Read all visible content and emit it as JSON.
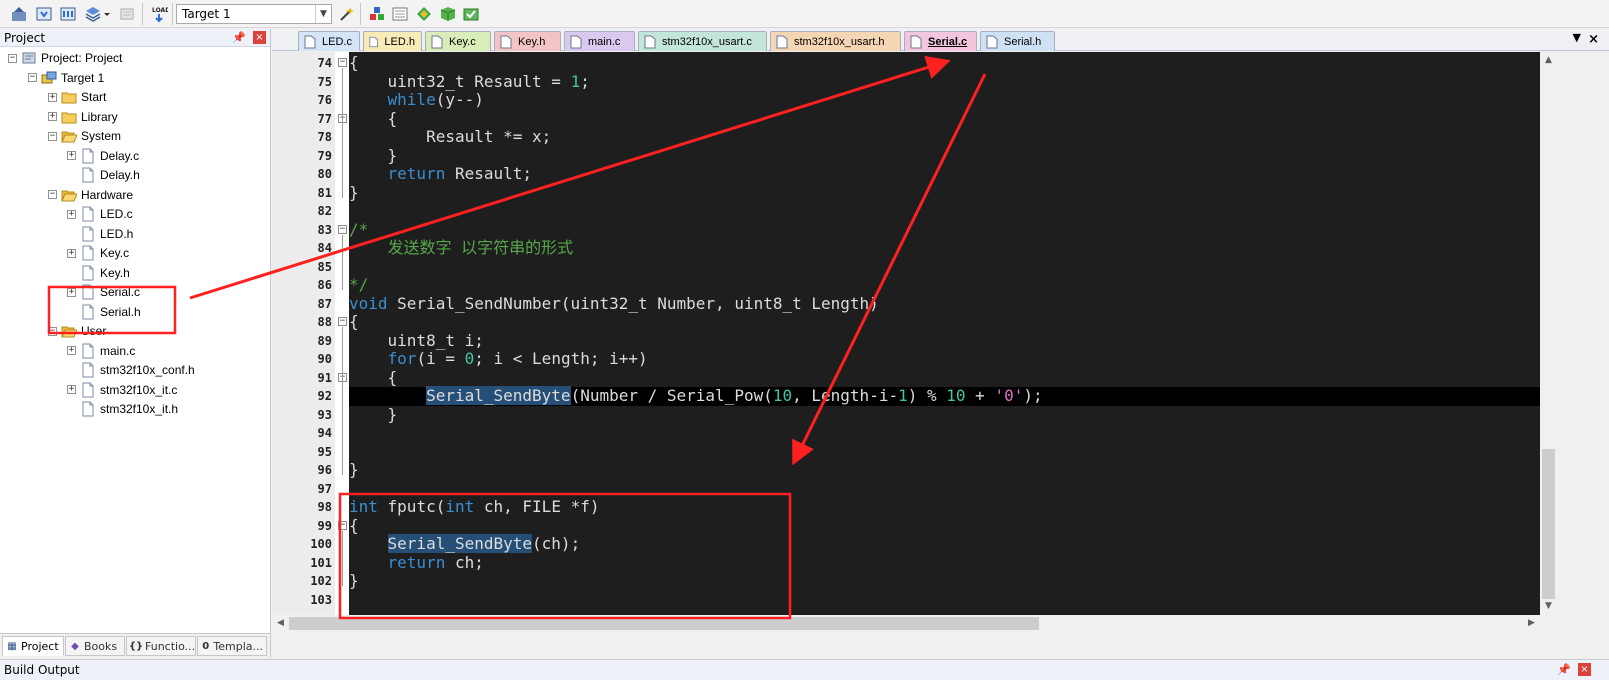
{
  "toolbar": {
    "target_value": "Target 1"
  },
  "project_panel": {
    "title": "Project",
    "pin_icon": "pin-icon",
    "tree": [
      {
        "label": "Project: Project",
        "level": 0,
        "icon": "project-icon",
        "toggle": "-"
      },
      {
        "label": "Target 1",
        "level": 1,
        "icon": "target-icon",
        "toggle": "-"
      },
      {
        "label": "Start",
        "level": 2,
        "icon": "folder-icon",
        "toggle": "+"
      },
      {
        "label": "Library",
        "level": 2,
        "icon": "folder-icon",
        "toggle": "+"
      },
      {
        "label": "System",
        "level": 2,
        "icon": "folder-open-icon",
        "toggle": "-"
      },
      {
        "label": "Delay.c",
        "level": 3,
        "icon": "file-icon",
        "toggle": "+"
      },
      {
        "label": "Delay.h",
        "level": 3,
        "icon": "file-icon",
        "toggle": ""
      },
      {
        "label": "Hardware",
        "level": 2,
        "icon": "folder-open-icon",
        "toggle": "-"
      },
      {
        "label": "LED.c",
        "level": 3,
        "icon": "file-icon",
        "toggle": "+"
      },
      {
        "label": "LED.h",
        "level": 3,
        "icon": "file-icon",
        "toggle": ""
      },
      {
        "label": "Key.c",
        "level": 3,
        "icon": "file-icon",
        "toggle": "+"
      },
      {
        "label": "Key.h",
        "level": 3,
        "icon": "file-icon",
        "toggle": ""
      },
      {
        "label": "Serial.c",
        "level": 3,
        "icon": "file-icon",
        "toggle": "+"
      },
      {
        "label": "Serial.h",
        "level": 3,
        "icon": "file-icon",
        "toggle": ""
      },
      {
        "label": "User",
        "level": 2,
        "icon": "folder-open-icon",
        "toggle": "-"
      },
      {
        "label": "main.c",
        "level": 3,
        "icon": "file-icon",
        "toggle": "+"
      },
      {
        "label": "stm32f10x_conf.h",
        "level": 3,
        "icon": "file-icon",
        "toggle": ""
      },
      {
        "label": "stm32f10x_it.c",
        "level": 3,
        "icon": "file-icon",
        "toggle": "+"
      },
      {
        "label": "stm32f10x_it.h",
        "level": 3,
        "icon": "file-icon",
        "toggle": ""
      }
    ],
    "bottom_tabs": [
      {
        "label": "Project",
        "icon": "project-tab-icon",
        "active": true
      },
      {
        "label": "Books",
        "icon": "books-icon",
        "active": false
      },
      {
        "label": "Functio...",
        "icon": "functions-icon",
        "active": false
      },
      {
        "label": "Templa...",
        "icon": "templates-icon",
        "active": false
      }
    ]
  },
  "editor_tabs": [
    {
      "label": "LED.c",
      "color": "#d6e4f7",
      "active": false
    },
    {
      "label": "LED.h",
      "color": "#f7ecb8",
      "active": false
    },
    {
      "label": "Key.c",
      "color": "#d9edb8",
      "active": false
    },
    {
      "label": "Key.h",
      "color": "#f3c4c6",
      "active": false
    },
    {
      "label": "main.c",
      "color": "#d9c9ee",
      "active": false
    },
    {
      "label": "stm32f10x_usart.c",
      "color": "#c4e6da",
      "active": false
    },
    {
      "label": "stm32f10x_usart.h",
      "color": "#f5d6b4",
      "active": false
    },
    {
      "label": "Serial.c",
      "color": "#f3c6dd",
      "active": true
    },
    {
      "label": "Serial.h",
      "color": "#cfe1f4",
      "active": false
    }
  ],
  "code_lines": [
    {
      "n": "74",
      "fold": "-",
      "html": "{"
    },
    {
      "n": "75",
      "fold": "",
      "html": "    uint32_t Resault = <span class=\"num\">1</span>;"
    },
    {
      "n": "76",
      "fold": "",
      "html": "    <span class=\"kw\">while</span>(y--)"
    },
    {
      "n": "77",
      "fold": "-",
      "html": "    {"
    },
    {
      "n": "78",
      "fold": "",
      "html": "        Resault *= x;"
    },
    {
      "n": "79",
      "fold": "",
      "html": "    }"
    },
    {
      "n": "80",
      "fold": "",
      "html": "    <span class=\"kw\">return</span> Resault;"
    },
    {
      "n": "81",
      "fold": "",
      "html": "}"
    },
    {
      "n": "82",
      "fold": "",
      "html": ""
    },
    {
      "n": "83",
      "fold": "-",
      "html": "<span class=\"cm\">/*</span>"
    },
    {
      "n": "84",
      "fold": "",
      "html": "<span class=\"cm\">    发送数字 以字符串的形式</span>"
    },
    {
      "n": "85",
      "fold": "",
      "html": ""
    },
    {
      "n": "86",
      "fold": "",
      "html": "<span class=\"cm\">*/</span>"
    },
    {
      "n": "87",
      "fold": "",
      "html": "<span class=\"kw\">void</span> Serial_SendNumber(uint32_t Number, uint8_t Length)"
    },
    {
      "n": "88",
      "fold": "-",
      "html": "{"
    },
    {
      "n": "89",
      "fold": "",
      "html": "    uint8_t i;"
    },
    {
      "n": "90",
      "fold": "",
      "html": "    <span class=\"kw\">for</span>(i = <span class=\"num\">0</span>; i &lt; Length; i++)"
    },
    {
      "n": "91",
      "fold": "-",
      "html": "    {"
    },
    {
      "n": "92",
      "fold": "",
      "html": "        <span class=\"fnhl\">Serial_SendByte</span>(Number / Serial_Pow(<span class=\"num\">10</span>, Length-i-<span class=\"num\">1</span>) % <span class=\"num\">10</span> + <span class=\"str\">'0'</span>);",
      "hl": true
    },
    {
      "n": "93",
      "fold": "",
      "html": "    }"
    },
    {
      "n": "94",
      "fold": "",
      "html": ""
    },
    {
      "n": "95",
      "fold": "",
      "html": ""
    },
    {
      "n": "96",
      "fold": "",
      "html": "}"
    },
    {
      "n": "97",
      "fold": "",
      "html": ""
    },
    {
      "n": "98",
      "fold": "",
      "html": "<span class=\"kw\">int</span> fputc(<span class=\"kw\">int</span> ch, FILE *f)"
    },
    {
      "n": "99",
      "fold": "-",
      "html": "{"
    },
    {
      "n": "100",
      "fold": "",
      "html": "    <span class=\"fnhl\">Serial_SendByte</span>(ch);"
    },
    {
      "n": "101",
      "fold": "",
      "html": "    <span class=\"kw\">return</span> ch;"
    },
    {
      "n": "102",
      "fold": "",
      "html": "}"
    },
    {
      "n": "103",
      "fold": "",
      "html": ""
    }
  ],
  "build_output": {
    "title": "Build Output"
  },
  "colors": {
    "annotation": "#ff2020",
    "editor_bg": "#1e1e1e",
    "keyword": "#3b8fd0",
    "comment": "#57a64a",
    "number": "#43c4a8"
  }
}
